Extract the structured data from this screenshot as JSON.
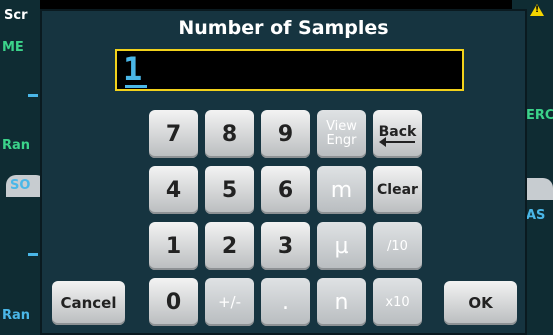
{
  "background": {
    "left_tabs": [
      "Scr",
      "ME",
      "Ran",
      "SO",
      "Ran"
    ],
    "right_tabs": [
      "ERC",
      "AS"
    ]
  },
  "dialog": {
    "title": "Number of Samples",
    "entry_value": "1"
  },
  "keypad": {
    "row1": [
      "7",
      "8",
      "9",
      "View Engr",
      "Back"
    ],
    "row2": [
      "4",
      "5",
      "6",
      "m",
      "Clear"
    ],
    "row3": [
      "1",
      "2",
      "3",
      "µ",
      "/10"
    ],
    "row4": [
      "0",
      "+/-",
      ".",
      "n",
      "x10"
    ]
  },
  "buttons": {
    "cancel": "Cancel",
    "ok": "OK"
  },
  "colors": {
    "dialog_bg": "#163440",
    "entry_border": "#f2d21b",
    "value_color": "#4ab7e8"
  }
}
